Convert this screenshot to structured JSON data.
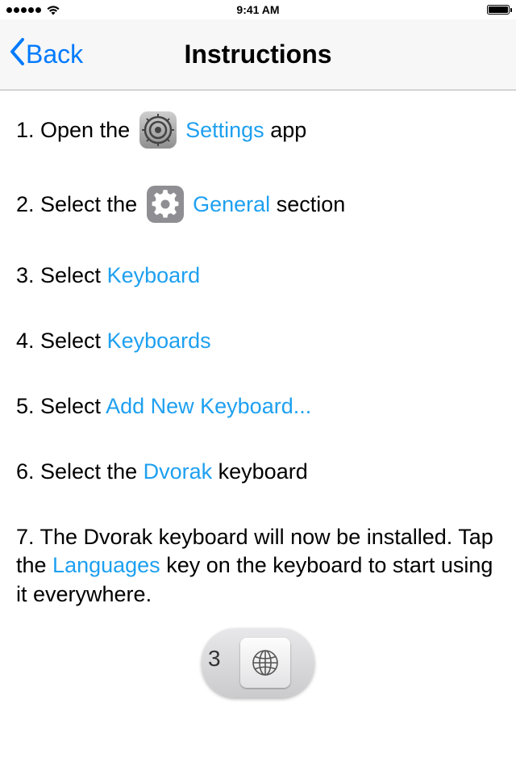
{
  "statusBar": {
    "time": "9:41 AM"
  },
  "nav": {
    "back": "Back",
    "title": "Instructions"
  },
  "steps": {
    "s1_prefix": "1. Open the ",
    "s1_link": "Settings",
    "s1_suffix": " app",
    "s2_prefix": "2. Select the ",
    "s2_link": "General",
    "s2_suffix": " section",
    "s3_prefix": "3. Select ",
    "s3_link": "Keyboard",
    "s4_prefix": "4. Select ",
    "s4_link": "Keyboards",
    "s5_prefix": "5. Select ",
    "s5_link": "Add New Keyboard...",
    "s6_prefix": "6. Select the ",
    "s6_link": "Dvorak",
    "s6_suffix": " keyboard",
    "s7_prefix": "7. The Dvorak keyboard will now be installed. Tap the ",
    "s7_link": "Languages",
    "s7_suffix": " key on the keyboard to start using it everywhere."
  },
  "keyImage": {
    "leftChar": "3"
  }
}
